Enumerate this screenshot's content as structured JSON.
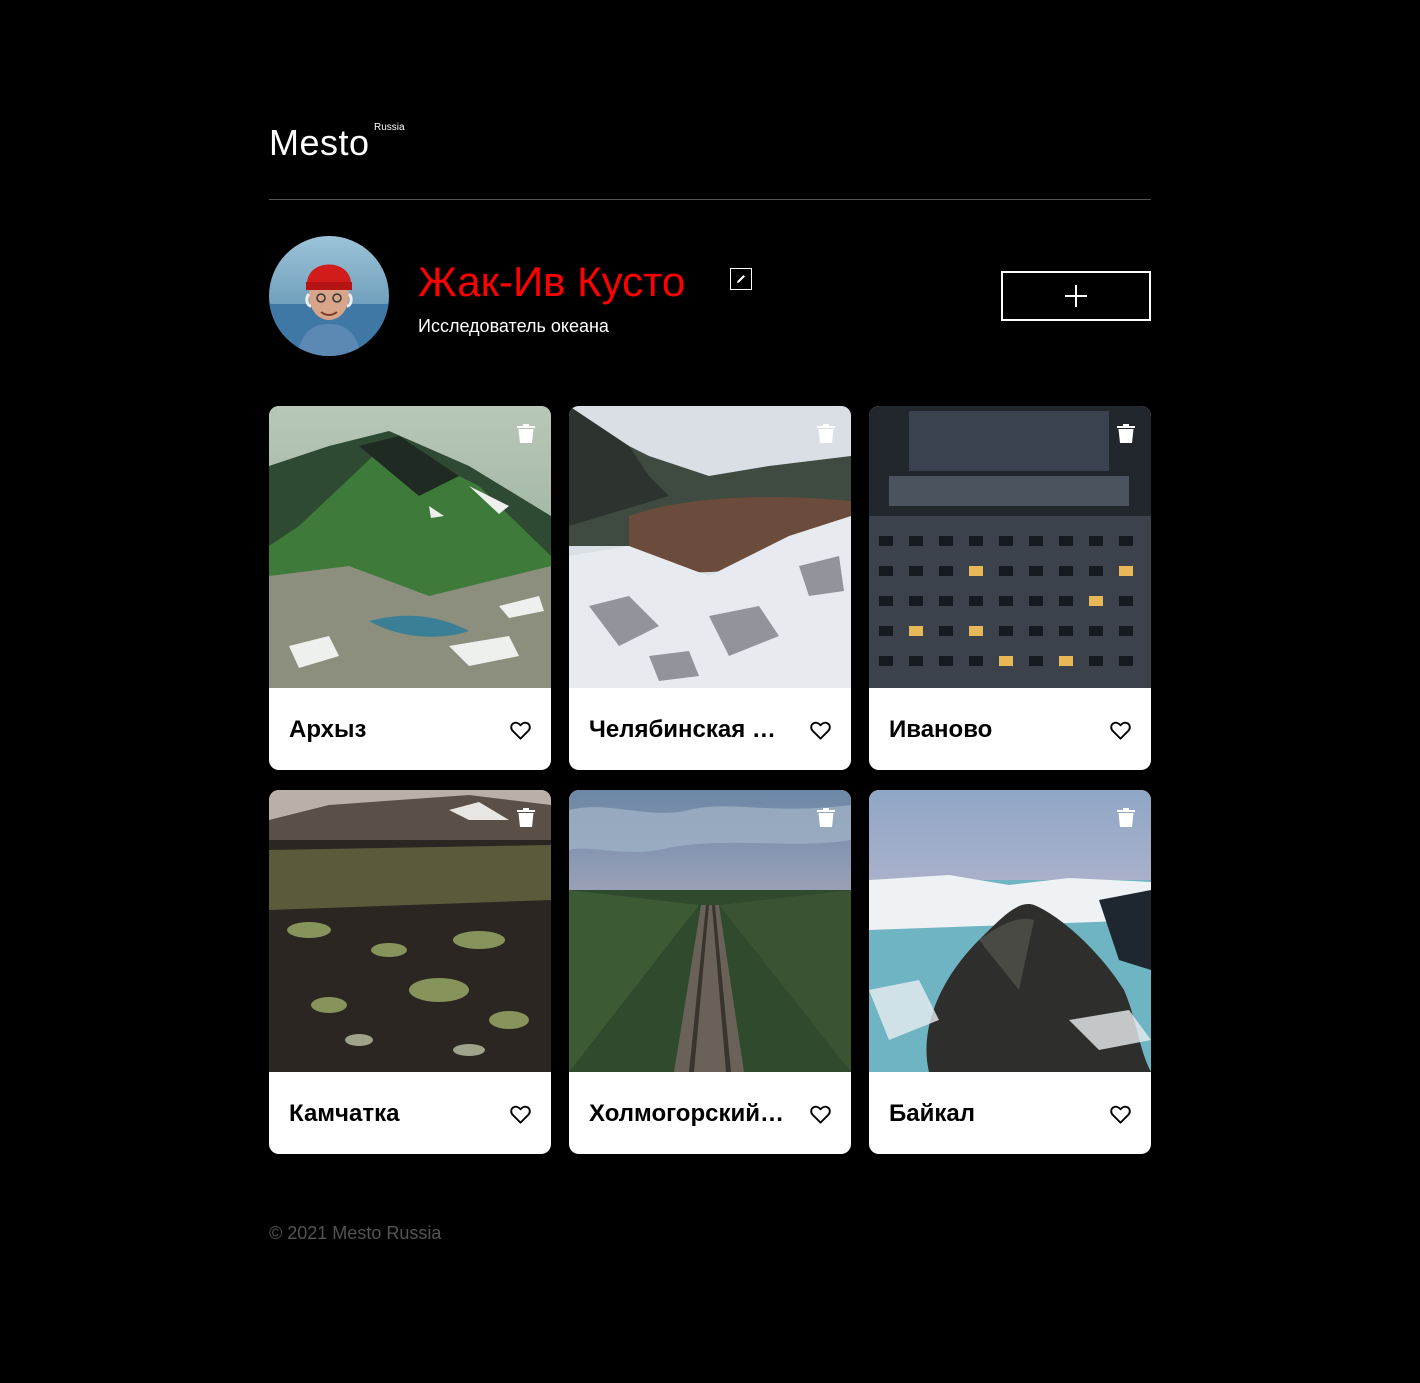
{
  "header": {
    "logo": "Mesto",
    "logo_sub": "Russia"
  },
  "profile": {
    "name": "Жак-Ив Кусто",
    "about": "Исследователь океана",
    "name_color": "#ff0000"
  },
  "cards": [
    {
      "title": "Архыз",
      "image_hint": "green mountain valley with snow patches and lake"
    },
    {
      "title": "Челябинская область",
      "image_hint": "river with snowy rocks and forest"
    },
    {
      "title": "Иваново",
      "image_hint": "soviet apartment blocks at dusk"
    },
    {
      "title": "Камчатка",
      "image_hint": "volcanic tundra with moss and mountain"
    },
    {
      "title": "Холмогорский район",
      "image_hint": "railway through forest under cloudy sky"
    },
    {
      "title": "Байкал",
      "image_hint": "rocky cliff on frozen lake shore"
    }
  ],
  "footer": {
    "copyright": "© 2021 Mesto Russia"
  },
  "icons": {
    "edit": "pencil-icon",
    "add": "plus-icon",
    "trash": "trash-icon",
    "like": "heart-outline-icon"
  }
}
